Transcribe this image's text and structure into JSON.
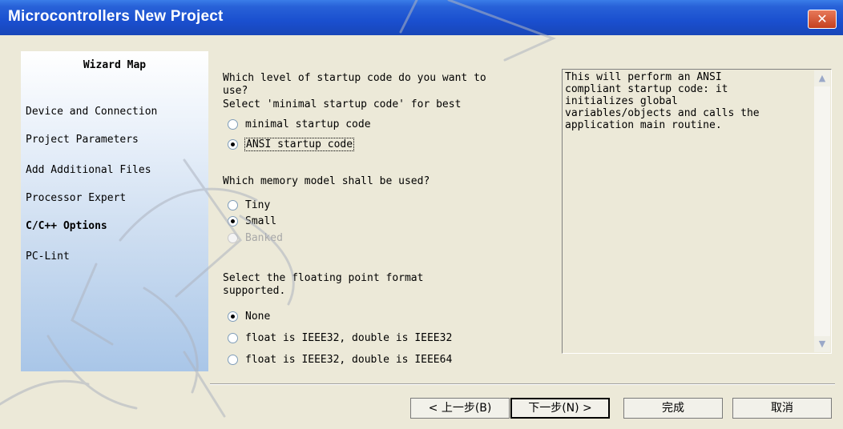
{
  "window": {
    "title": "Microcontrollers New Project",
    "close_label": "✕"
  },
  "wizard": {
    "title": "Wizard Map",
    "items": [
      {
        "label": "Device and Connection",
        "active": false
      },
      {
        "label": "Project Parameters",
        "active": false
      },
      {
        "label": "Add Additional Files",
        "active": false
      },
      {
        "label": "Processor Expert",
        "active": false
      },
      {
        "label": "C/C++ Options",
        "active": true
      },
      {
        "label": "PC-Lint",
        "active": false
      }
    ]
  },
  "startup": {
    "question_line1": "Which level of startup code do you want to",
    "question_line2": "use?",
    "hint": "Select 'minimal startup code' for best",
    "options": [
      {
        "label": "minimal startup code",
        "selected": false
      },
      {
        "label": "ANSI startup code",
        "selected": true
      }
    ]
  },
  "memory": {
    "question": "Which memory model shall be used?",
    "options": [
      {
        "label": "Tiny",
        "selected": false,
        "disabled": false
      },
      {
        "label": "Small",
        "selected": true,
        "disabled": false
      },
      {
        "label": "Banked",
        "selected": false,
        "disabled": true
      }
    ]
  },
  "float": {
    "question_line1": "Select the floating point format",
    "question_line2": "supported.",
    "options": [
      {
        "label": "None",
        "selected": true
      },
      {
        "label": "float is IEEE32, double is IEEE32",
        "selected": false
      },
      {
        "label": "float is IEEE32, double is IEEE64",
        "selected": false
      }
    ]
  },
  "description": {
    "text": "This will perform an ANSI\ncompliant startup code: it\ninitializes global\nvariables/objects and calls the\napplication main routine."
  },
  "scroll": {
    "up_icon": "▲",
    "down_icon": "▼"
  },
  "buttons": {
    "back": "< 上一步(B)",
    "next": "下一步(N) >",
    "finish": "完成",
    "cancel": "取消"
  },
  "colors": {
    "titlebar": "#1a4fcf",
    "close": "#c5401e",
    "dialog_bg": "#ece9d8",
    "watermark": "#aeb4c0"
  }
}
